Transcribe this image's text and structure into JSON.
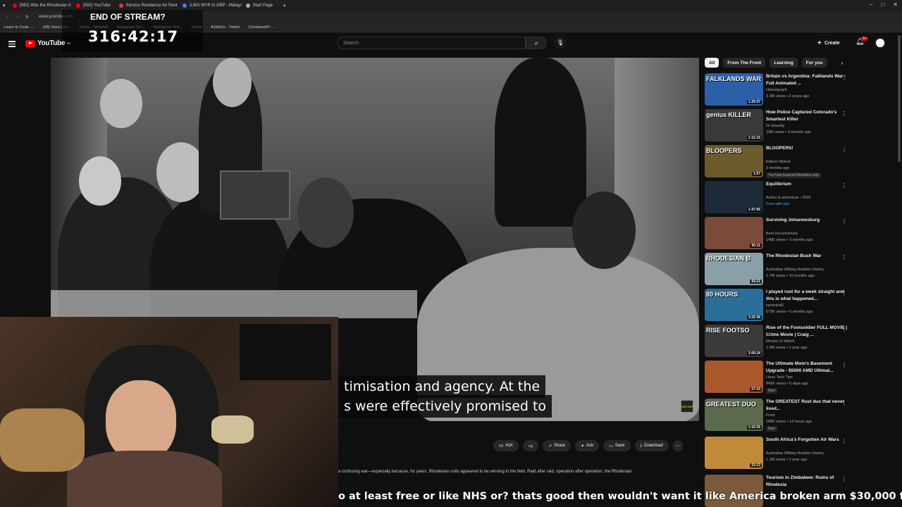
{
  "browser": {
    "tabs": [
      {
        "label": "(592) Was the Rhodesian A",
        "color": "#ff0000"
      },
      {
        "label": "(592) YouTube",
        "color": "#ff0000"
      },
      {
        "label": "Service Residence for Rent",
        "color": "#e0383e"
      },
      {
        "label": "3,600 MYR to GBP - Malays",
        "color": "#4285f4"
      },
      {
        "label": "Start Page",
        "color": "#aaaaaa"
      }
    ],
    "new_tab": "+",
    "address": "www.youtube.com",
    "bookmarks": [
      "Learn to Code -...",
      "(48) Inbox | ed...",
      "Home - SteamID",
      "Singapore Tim...",
      "Markdown Text...",
      "Steam",
      "A1biDrix - Twitch",
      "ClockworkPi - ..."
    ],
    "window_controls": [
      "–",
      "□",
      "✕"
    ]
  },
  "stream": {
    "title": "END OF STREAM?",
    "timer": "316:42:17"
  },
  "youtube": {
    "logo": "YouTube",
    "logo_sup": "FR",
    "search_placeholder": "Search",
    "create_label": "Create",
    "notifications_badge": "9+"
  },
  "video": {
    "caption_line1": "timisation and agency. At the",
    "caption_line2": "s were effectively promised to"
  },
  "actions": {
    "likes": "41K",
    "share": "Share",
    "ask": "Ask",
    "save": "Save",
    "download": "Download",
    "more": "⋯"
  },
  "description": "a confusing war—especially because, for years, Rhodesian units appeared to be winning in the field. Raid after raid, operation after operation, the Rhodesian",
  "chat_line": "o at least free or like NHS or? thats good then wouldn't want it like America broken arm $30,000 fcuk that",
  "chips": [
    "All",
    "From The Front",
    "Learning",
    "For you"
  ],
  "recommendations": [
    {
      "title": "Britain vs Argentina: Falklands War - Full Animated ...",
      "channel": "Historigraph",
      "meta": "3.3M views • 2 years ago",
      "duration": "1:25:07",
      "thumb_text": "FALKLANDS WAR",
      "thumb_color": "#2b5fa8",
      "badge": ""
    },
    {
      "title": "How Police Captured Colorado's Smartest Killer",
      "channel": "Dr Insanity",
      "meta": "23M views • 4 months ago",
      "duration": "1:12:15",
      "thumb_text": "genius KILLER",
      "thumb_color": "#3a3a3a",
      "badge": ""
    },
    {
      "title": "BLOOPERS!",
      "channel": "Edison Motors",
      "meta": "3 months ago",
      "duration": "1:57",
      "thumb_text": "BLOOPERS",
      "thumb_color": "#6b5a2a",
      "badge": "YouTube featured  Members only"
    },
    {
      "title": "Equilibrium",
      "channel": "Action & adventure • 2002",
      "meta": "Free with ads",
      "duration": "1:47:06",
      "thumb_text": "",
      "thumb_color": "#1d2a3a",
      "badge": ""
    },
    {
      "title": "Surviving Johannesburg",
      "channel": "Best Documentary",
      "meta": "148K views • 3 months ago",
      "duration": "50:11",
      "thumb_text": "",
      "thumb_color": "#7a4a3a",
      "badge": ""
    },
    {
      "title": "The Rhodesian Bush War",
      "channel": "Australian Military Aviation History",
      "meta": "1.7M views • 10 months ago",
      "duration": "43:21",
      "thumb_text": "RHODESIAN B",
      "thumb_color": "#8aa0a8",
      "badge": ""
    },
    {
      "title": "I played rust for a week straight and this is what happened...",
      "channel": "spoonkid2",
      "meta": "670K views • 6 months ago",
      "duration": "3:22:46",
      "thumb_text": "80 HOURS",
      "thumb_color": "#2a6f9a",
      "badge": ""
    },
    {
      "title": "Rise of the Footsoldier FULL MOVIE | Crime Movie | Craig ...",
      "channel": "Movies to Watch",
      "meta": "2.6M views • 1 year ago",
      "duration": "2:05:24",
      "thumb_text": "RISE FOOTSO",
      "thumb_color": "#3b3b3b",
      "badge": ""
    },
    {
      "title": "The Ultimate Mom's Basement Upgrade - $5000 AMD Ultimat...",
      "channel": "Linus Tech Tips",
      "meta": "842K views • 5 days ago",
      "duration": "27:43",
      "thumb_text": "",
      "thumb_color": "#a8582a",
      "badge": "New"
    },
    {
      "title": "The GREATEST Rust duo that never lived...",
      "channel": "Frost",
      "meta": "186K views • 14 hours ago",
      "duration": "1:10:25",
      "thumb_text": "GREATEST DUO",
      "thumb_color": "#5a6a4a",
      "badge": "New"
    },
    {
      "title": "South Africa's Forgotten Air Wars",
      "channel": "Australian Military Aviation History",
      "meta": "1.1M views • 1 year ago",
      "duration": "33:13",
      "thumb_text": "",
      "thumb_color": "#c08a3a",
      "badge": ""
    },
    {
      "title": "Tourism in Zimbabwe: Ruins of Rhodesia",
      "channel": "",
      "meta": "",
      "duration": "",
      "thumb_text": "",
      "thumb_color": "#7a5a3a",
      "badge": ""
    }
  ]
}
